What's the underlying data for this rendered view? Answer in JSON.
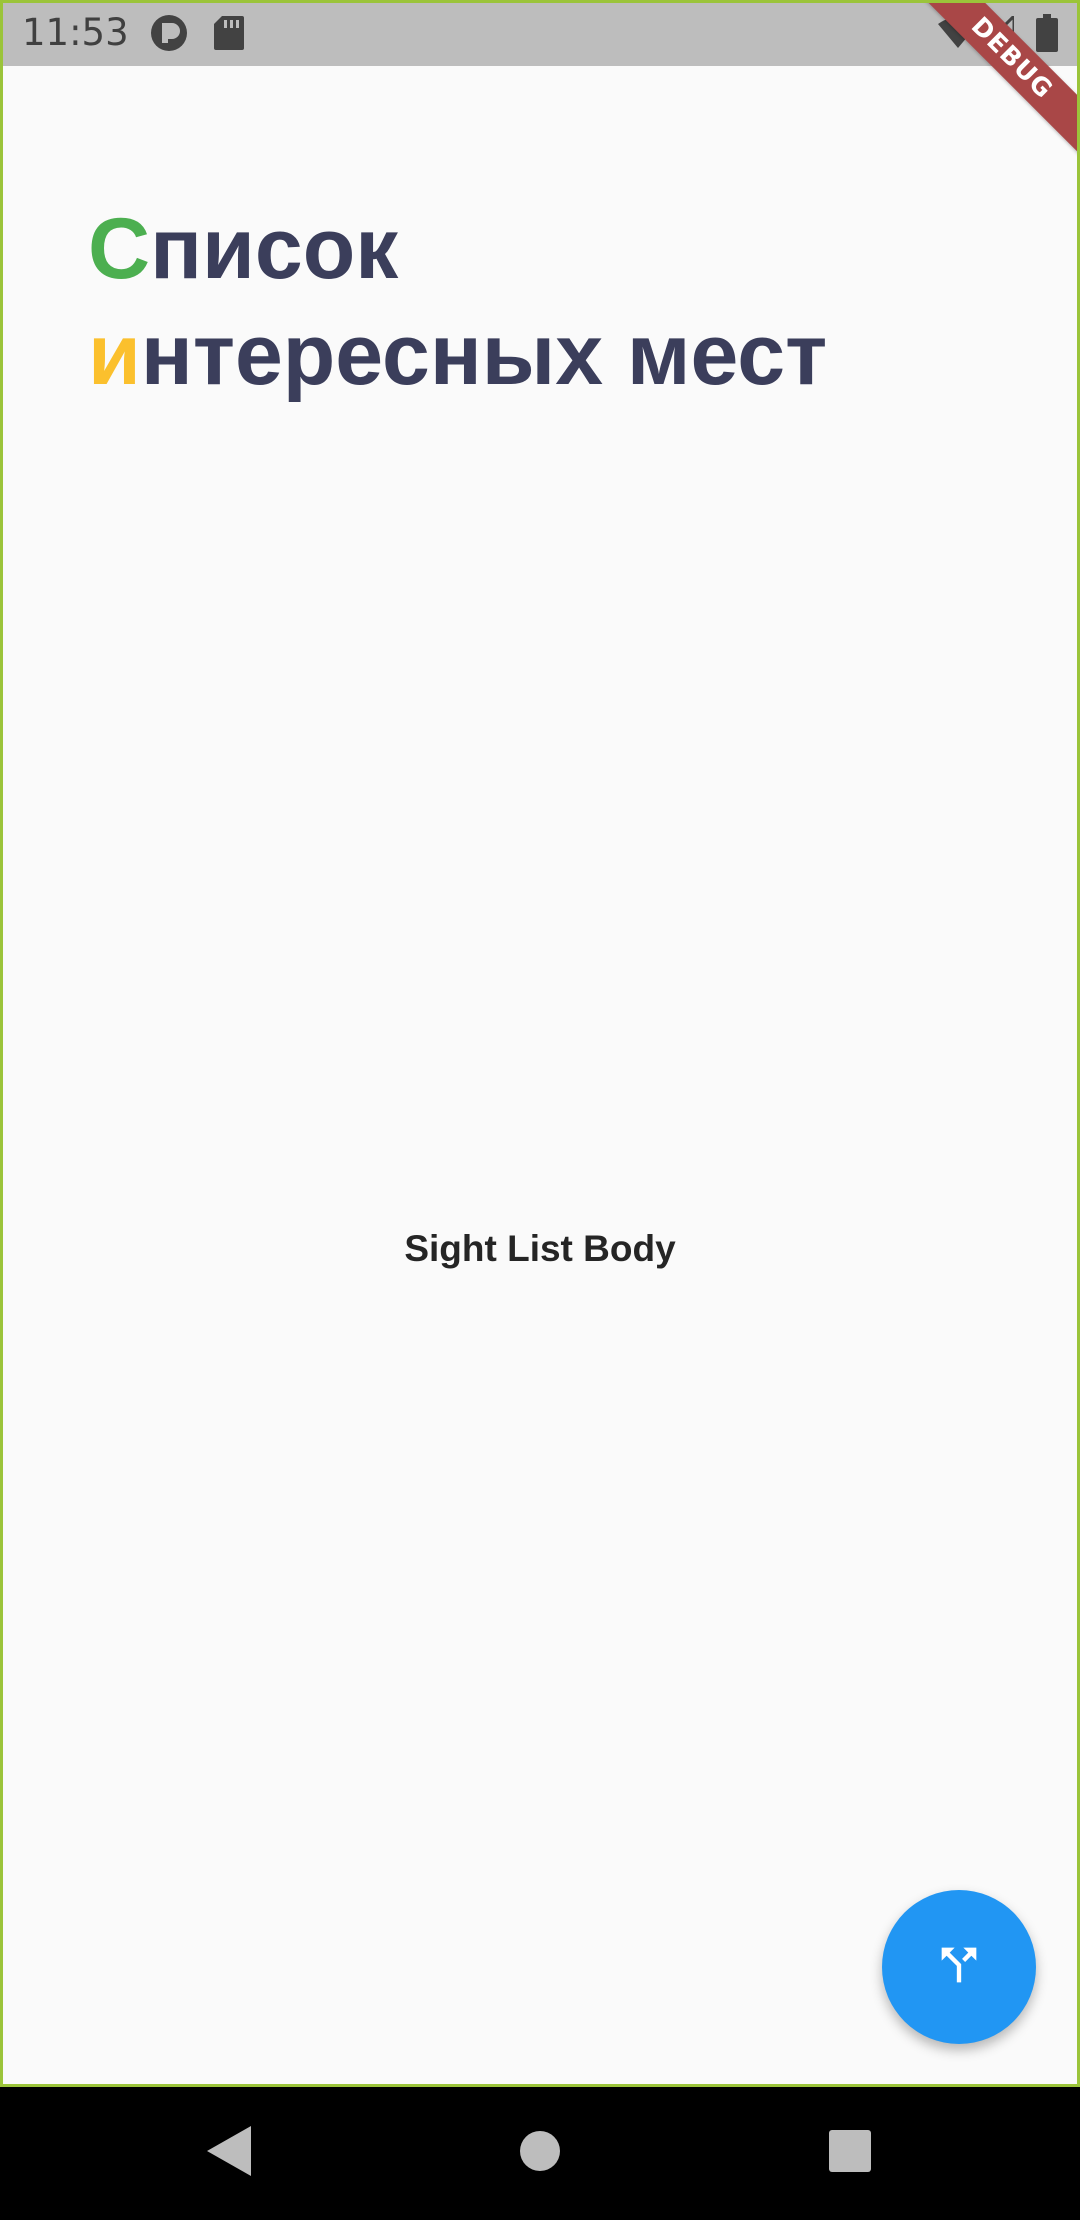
{
  "status_bar": {
    "time": "11:53",
    "icons": [
      "app-notification-icon",
      "sd-card-icon",
      "wifi-icon",
      "signal-icon",
      "battery-icon"
    ]
  },
  "debug_banner": "DEBUG",
  "header": {
    "line1_first": "С",
    "line1_rest": "писок",
    "line2_first": "и",
    "line2_rest": "нтересных мест"
  },
  "body": {
    "text": "Sight List Body"
  },
  "fab": {
    "icon": "merge-icon"
  },
  "nav_bar": {
    "buttons": [
      "back-icon",
      "home-icon",
      "recents-icon"
    ]
  },
  "colors": {
    "title": "#3b3e5b",
    "accent_green": "#4caf50",
    "accent_yellow": "#fbc02d",
    "fab": "#2196f3",
    "status_bar": "#bdbdbd",
    "background": "#fafafa"
  }
}
